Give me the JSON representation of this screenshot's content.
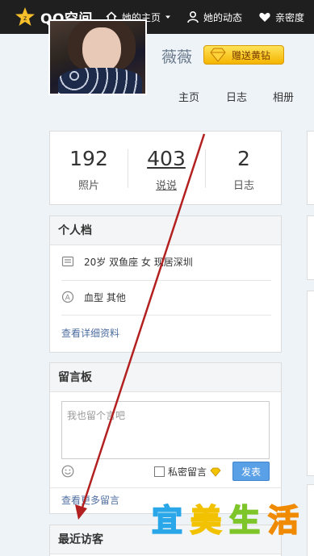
{
  "topbar": {
    "logo_text": "QQ空间",
    "nav": {
      "home": "她的主页",
      "feed": "她的动态",
      "close": "亲密度"
    }
  },
  "profile": {
    "username": "薇薇",
    "vip_label": "赠送黄钻",
    "tabs": {
      "home": "主页",
      "blog": "日志",
      "album": "相册"
    }
  },
  "stats": {
    "photos": {
      "value": "192",
      "label": "照片"
    },
    "talk": {
      "value": "403",
      "label": "说说"
    },
    "diary": {
      "value": "2",
      "label": "日志"
    }
  },
  "profile_card": {
    "title": "个人档",
    "age_line": "20岁  双鱼座 女 现居深圳",
    "blood_line": "血型 其他",
    "more_link": "查看详细资料"
  },
  "guestbook": {
    "title": "留言板",
    "placeholder": "我也留个言吧",
    "private_label": "私密留言",
    "post_label": "发表",
    "more_link": "查看更多留言"
  },
  "visitors": {
    "title": "最近访客"
  },
  "watermark": {
    "chars": [
      "宜",
      "美",
      "生",
      "活"
    ]
  },
  "colors": {
    "topbar": "#1f1f1f",
    "background": "#eef3f8",
    "link": "#4e6ea0",
    "post_button": "#5aa0e6",
    "vip_gold": "#f4b400",
    "arrow": "#b32020"
  }
}
